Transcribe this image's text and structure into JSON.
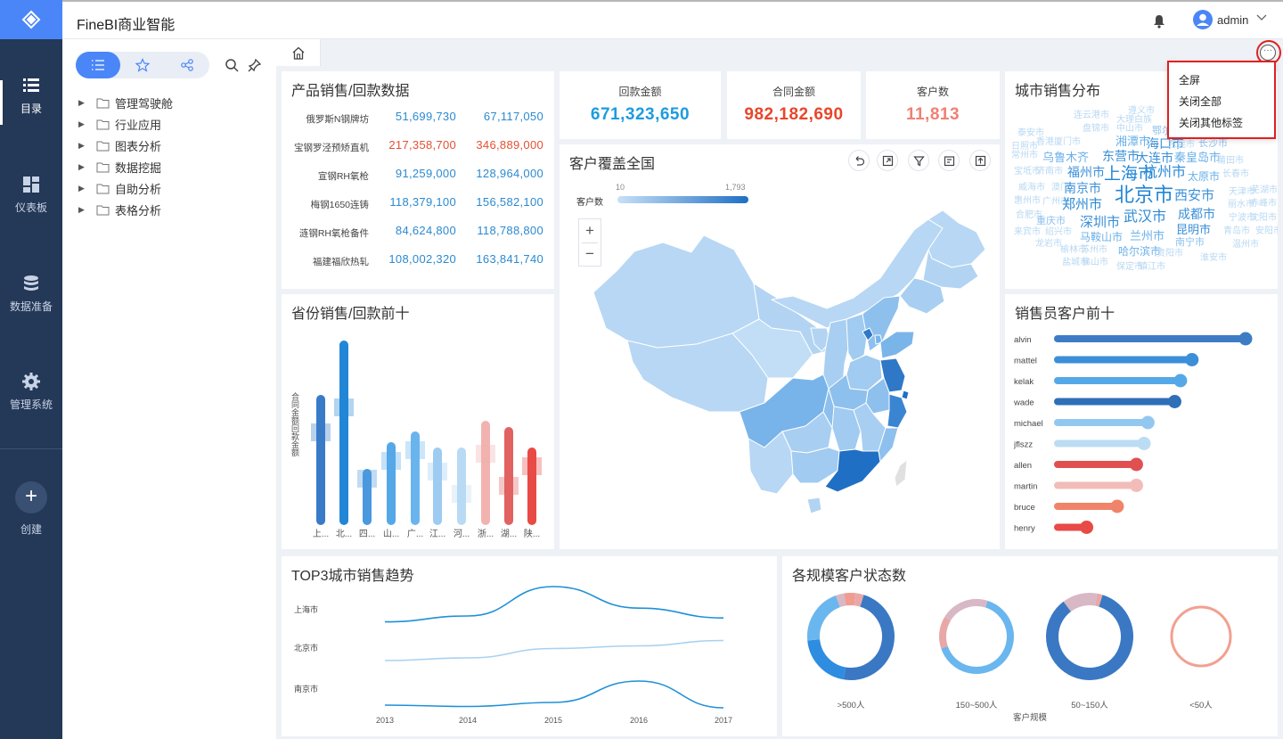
{
  "app": {
    "title": "FineBI商业智能",
    "user": "admin"
  },
  "nav": [
    {
      "label": "目录",
      "icon": "list-icon",
      "active": true
    },
    {
      "label": "仪表板",
      "icon": "dashboard-icon",
      "active": false
    },
    {
      "label": "数据准备",
      "icon": "database-icon",
      "active": false
    },
    {
      "label": "管理系统",
      "icon": "gear-icon",
      "active": false
    }
  ],
  "create_label": "创建",
  "tree": [
    {
      "label": "管理驾驶舱"
    },
    {
      "label": "行业应用"
    },
    {
      "label": "图表分析"
    },
    {
      "label": "数据挖掘"
    },
    {
      "label": "自助分析"
    },
    {
      "label": "表格分析"
    }
  ],
  "menu": {
    "items": [
      "全屏",
      "关闭全部",
      "关闭其他标签"
    ]
  },
  "widgets": {
    "product": {
      "title": "产品销售/回款数据",
      "rows": [
        {
          "name": "俄罗斯N钢牌坊",
          "a": "51,699,730",
          "b": "67,117,050",
          "color": "#2b8ad0"
        },
        {
          "name": "宝钢罗泾预矫直机",
          "a": "217,358,700",
          "b": "346,889,000",
          "color": "#e54f33"
        },
        {
          "name": "宣钢RH氧枪",
          "a": "91,259,000",
          "b": "128,964,000",
          "color": "#2b8ad0"
        },
        {
          "name": "梅钢1650连铸",
          "a": "118,379,100",
          "b": "156,582,100",
          "color": "#2b8ad0"
        },
        {
          "name": "涟钢RH氧枪备件",
          "a": "84,624,800",
          "b": "118,788,800",
          "color": "#2b8ad0"
        },
        {
          "name": "福建福欣热轧",
          "a": "108,002,320",
          "b": "163,841,740",
          "color": "#2b8ad0"
        }
      ]
    },
    "kpi": [
      {
        "label": "回款金额",
        "value": "671,323,650",
        "color": "#1e9be0"
      },
      {
        "label": "合同金额",
        "value": "982,182,690",
        "color": "#e8462a"
      },
      {
        "label": "客户数",
        "value": "11,813",
        "color": "#f08074"
      }
    ],
    "map": {
      "title": "客户覆盖全国",
      "legend_label": "客户数",
      "legend_min": "10",
      "legend_max": "1,793",
      "zoom_in": "+",
      "zoom_out": "−"
    },
    "wordcloud": {
      "title": "城市销售分布",
      "words": [
        "连云港市",
        "遵义市",
        "大理白族",
        "中山市",
        "泰安市",
        "盘锦市",
        "鄂尔多",
        "日照市",
        "香港厦门市",
        "湘潭市",
        "海口市",
        "东莞市",
        "长沙市",
        "常州市",
        "乌鲁木齐",
        "东营市",
        "大连市",
        "秦皇岛市",
        "莆田市",
        "宝坻市",
        "济南市",
        "福州市",
        "上海市",
        "杭州市",
        "太原市",
        "长春市",
        "威海市",
        "澳门",
        "南京市",
        "天津市",
        "芜湖市",
        "惠州市",
        "广州市",
        "郑州市",
        "北京市",
        "西安市",
        "丽水市",
        "赤峰市",
        "合肥市",
        "成都市",
        "宁波市",
        "沈阳市",
        "重庆市",
        "深圳市",
        "武汉市",
        "来宾市",
        "绍兴市",
        "马鞍山市",
        "兰州市",
        "昆明市",
        "青岛市",
        "安阳市",
        "龙岩市",
        "榆林市",
        "苏州市",
        "哈尔滨市",
        "南宁市",
        "温州市",
        "盐城市",
        "佛山市",
        "贵阳市",
        "淮安市",
        "保定市",
        "镇江市"
      ]
    },
    "province": {
      "title": "省份销售/回款前十",
      "ylabel": "合同金额回款金额"
    },
    "sales_rep": {
      "title": "销售员客户前十"
    },
    "trend": {
      "title": "TOP3城市销售趋势"
    },
    "donut": {
      "title": "各规模客户状态数",
      "xlabel": "客户规模"
    }
  },
  "chart_data": [
    {
      "type": "bar",
      "title": "省份销售/回款前十",
      "ylabel": "合同金额回款金额",
      "categories": [
        "上...",
        "北...",
        "四...",
        "山...",
        "广...",
        "江...",
        "河...",
        "浙...",
        "湖...",
        "陕..."
      ],
      "series": [
        {
          "values": [
            146,
            207,
            63,
            93,
            105,
            87,
            87,
            117,
            110,
            87
          ]
        },
        {
          "values": [
            104,
            132,
            52,
            72,
            84,
            60,
            35,
            80,
            44,
            66
          ]
        }
      ],
      "colors": [
        "#3a7bc8",
        "#2186d6",
        "#4a98de",
        "#55a8e8",
        "#6ab4ee",
        "#9dcbf2",
        "#b9daf4",
        "#f2b3b0",
        "#e26262",
        "#e84a45"
      ]
    },
    {
      "type": "bar",
      "title": "销售员客户前十",
      "categories": [
        "alvin",
        "mattel",
        "kelak",
        "wade",
        "michael",
        "jflszz",
        "allen",
        "martin",
        "bruce",
        "henry"
      ],
      "values": [
        100,
        72,
        66,
        63,
        49,
        47,
        43,
        43,
        33,
        17
      ],
      "colors": [
        "#3d7cc4",
        "#3b8fd8",
        "#55a8e8",
        "#2f6fb8",
        "#92c8f0",
        "#bcdcf4",
        "#e05050",
        "#f2bcb8",
        "#f0846a",
        "#e84a45"
      ]
    },
    {
      "type": "line",
      "title": "TOP3城市销售趋势",
      "x": [
        "2013",
        "2014",
        "2015",
        "2016",
        "2017"
      ],
      "series": [
        {
          "name": "上海市",
          "values": [
            0.1,
            0.25,
            1.0,
            0.45,
            0.2
          ]
        },
        {
          "name": "北京市",
          "values": [
            0.1,
            0.2,
            0.55,
            0.65,
            0.85
          ]
        },
        {
          "name": "南京市",
          "values": [
            0.1,
            0.05,
            0.2,
            1.0,
            0.0
          ]
        }
      ],
      "colors": [
        "#1e90d8",
        "#a9d1f0",
        "#1e90d8"
      ]
    },
    {
      "type": "pie",
      "title": "各规模客户状态数",
      "xlabel": "客户规模",
      "categories": [
        ">500人",
        "150~500人",
        "50~150人",
        "<50人"
      ],
      "series": [
        {
          "name": ">500人",
          "values": [
            46,
            20,
            20,
            3,
            4,
            3
          ]
        },
        {
          "name": "150~500人",
          "values": [
            65,
            14,
            21
          ]
        },
        {
          "name": "50~150人",
          "values": [
            85,
            13,
            2
          ]
        },
        {
          "name": "<50人",
          "values": [
            100
          ]
        }
      ],
      "colors": [
        "#3a78c4",
        "#2e8de0",
        "#6ab6ee",
        "#d8b8c4",
        "#f09c90",
        "#e8eef5",
        "#e8a8a8",
        "#f2b4ac"
      ]
    }
  ]
}
